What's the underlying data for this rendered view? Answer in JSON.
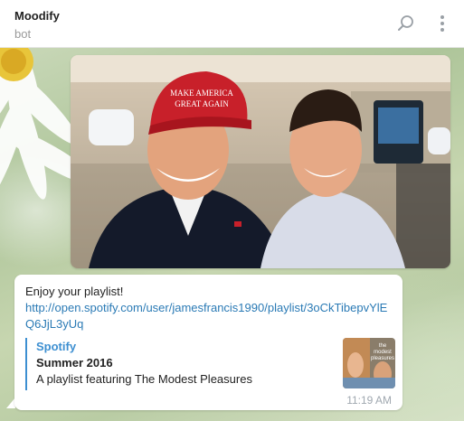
{
  "header": {
    "title": "Moodify",
    "status": "bot",
    "icons": {
      "search": "search-icon",
      "more": "more-vertical-icon"
    }
  },
  "photo": {
    "cap_text_line1": "MAKE AMERICA",
    "cap_text_line2": "GREAT AGAIN"
  },
  "message": {
    "text": "Enjoy your playlist!",
    "link": "http://open.spotify.com/user/jamesfrancis1990/playlist/3oCkTibepvYlEQ6JjL3yUq",
    "preview": {
      "site": "Spotify",
      "title": "Summer 2016",
      "description": "A playlist featuring The Modest Pleasures",
      "thumb_text_1": "the",
      "thumb_text_2": "modest",
      "thumb_text_3": "pleasures"
    },
    "time": "11:19 AM"
  },
  "colors": {
    "link": "#2a7ab5",
    "accent": "#3d8fd1",
    "bubble": "#ffffff",
    "cap_red": "#c8202a"
  }
}
